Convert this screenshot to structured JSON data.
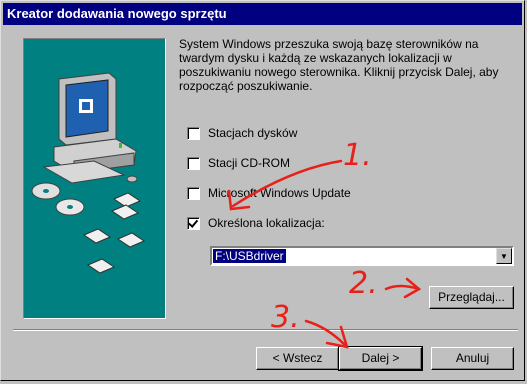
{
  "window": {
    "title": "Kreator dodawania nowego sprzętu"
  },
  "description": "System Windows przeszuka swoją bazę sterowników na twardym dysku i każdą ze wskazanych lokalizacji w poszukiwaniu nowego sterownika. Kliknij przycisk Dalej, aby rozpocząć poszukiwanie.",
  "options": [
    {
      "label": "Stacjach dysków",
      "checked": false
    },
    {
      "label": "Stacji CD-ROM",
      "checked": false
    },
    {
      "label": "Microsoft Windows Update",
      "checked": false
    },
    {
      "label": "Określona lokalizacja:",
      "checked": true
    }
  ],
  "location": {
    "value": "F:\\USBdriver"
  },
  "buttons": {
    "browse": "Przeglądaj...",
    "back": "< Wstecz",
    "next": "Dalej >",
    "cancel": "Anuluj"
  },
  "annotations": {
    "a1": "1.",
    "a2": "2.",
    "a3": "3."
  },
  "colors": {
    "title_bg": "#000080",
    "art_bg": "#008080",
    "annotation": "#e8201a"
  }
}
